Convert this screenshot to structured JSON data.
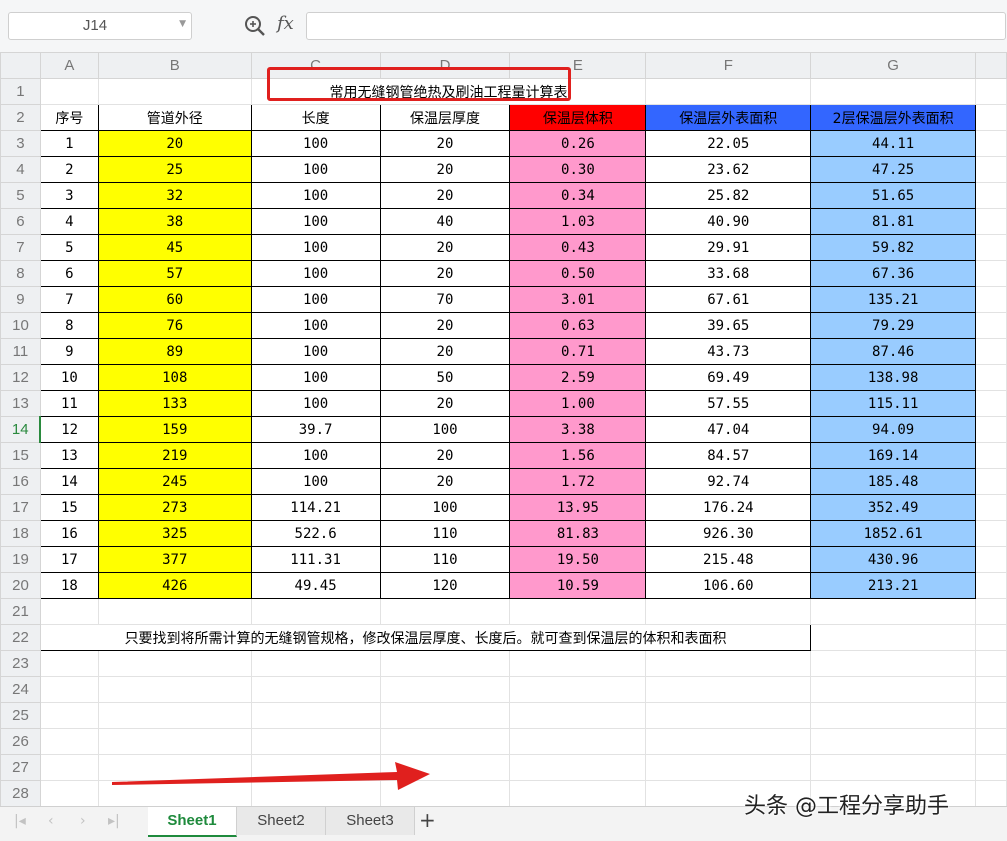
{
  "formula_bar": {
    "name_box": "J14",
    "fx_label": "fx",
    "formula": ""
  },
  "columns": [
    "A",
    "B",
    "C",
    "D",
    "E",
    "F",
    "G"
  ],
  "rows": [
    "1",
    "2",
    "3",
    "4",
    "5",
    "6",
    "7",
    "8",
    "9",
    "10",
    "11",
    "12",
    "13",
    "14",
    "15",
    "16",
    "17",
    "18",
    "19",
    "20",
    "21",
    "22",
    "23",
    "24",
    "25",
    "26",
    "27",
    "28"
  ],
  "title": "常用无缝钢管绝热及刷油工程量计算表",
  "headers": [
    "序号",
    "管道外径",
    "长度",
    "保温层厚度",
    "保温层体积",
    "保温层外表面积",
    "2层保温层外表面积"
  ],
  "data_rows": [
    [
      "1",
      "20",
      "100",
      "20",
      "0.26",
      "22.05",
      "44.11"
    ],
    [
      "2",
      "25",
      "100",
      "20",
      "0.30",
      "23.62",
      "47.25"
    ],
    [
      "3",
      "32",
      "100",
      "20",
      "0.34",
      "25.82",
      "51.65"
    ],
    [
      "4",
      "38",
      "100",
      "40",
      "1.03",
      "40.90",
      "81.81"
    ],
    [
      "5",
      "45",
      "100",
      "20",
      "0.43",
      "29.91",
      "59.82"
    ],
    [
      "6",
      "57",
      "100",
      "20",
      "0.50",
      "33.68",
      "67.36"
    ],
    [
      "7",
      "60",
      "100",
      "70",
      "3.01",
      "67.61",
      "135.21"
    ],
    [
      "8",
      "76",
      "100",
      "20",
      "0.63",
      "39.65",
      "79.29"
    ],
    [
      "9",
      "89",
      "100",
      "20",
      "0.71",
      "43.73",
      "87.46"
    ],
    [
      "10",
      "108",
      "100",
      "50",
      "2.59",
      "69.49",
      "138.98"
    ],
    [
      "11",
      "133",
      "100",
      "20",
      "1.00",
      "57.55",
      "115.11"
    ],
    [
      "12",
      "159",
      "39.7",
      "100",
      "3.38",
      "47.04",
      "94.09"
    ],
    [
      "13",
      "219",
      "100",
      "20",
      "1.56",
      "84.57",
      "169.14"
    ],
    [
      "14",
      "245",
      "100",
      "20",
      "1.72",
      "92.74",
      "185.48"
    ],
    [
      "15",
      "273",
      "114.21",
      "100",
      "13.95",
      "176.24",
      "352.49"
    ],
    [
      "16",
      "325",
      "522.6",
      "110",
      "81.83",
      "926.30",
      "1852.61"
    ],
    [
      "17",
      "377",
      "111.31",
      "110",
      "19.50",
      "215.48",
      "430.96"
    ],
    [
      "18",
      "426",
      "49.45",
      "120",
      "10.59",
      "106.60",
      "213.21"
    ]
  ],
  "note": "只要找到将所需计算的无缝钢管规格，修改保温层厚度、长度后。就可查到保温层的体积和表面积",
  "active_row": "14",
  "sheet_tabs": [
    "Sheet1",
    "Sheet2",
    "Sheet3"
  ],
  "active_sheet": "Sheet1",
  "add_sheet_label": "+",
  "watermark": "头条 @工程分享助手",
  "colors": {
    "yellow": "#ffff00",
    "pink": "#ff99cc",
    "blue": "#99ccff",
    "header_red": "#ff0000",
    "header_blue": "#3366ff",
    "annotation_red": "#e0201e"
  }
}
